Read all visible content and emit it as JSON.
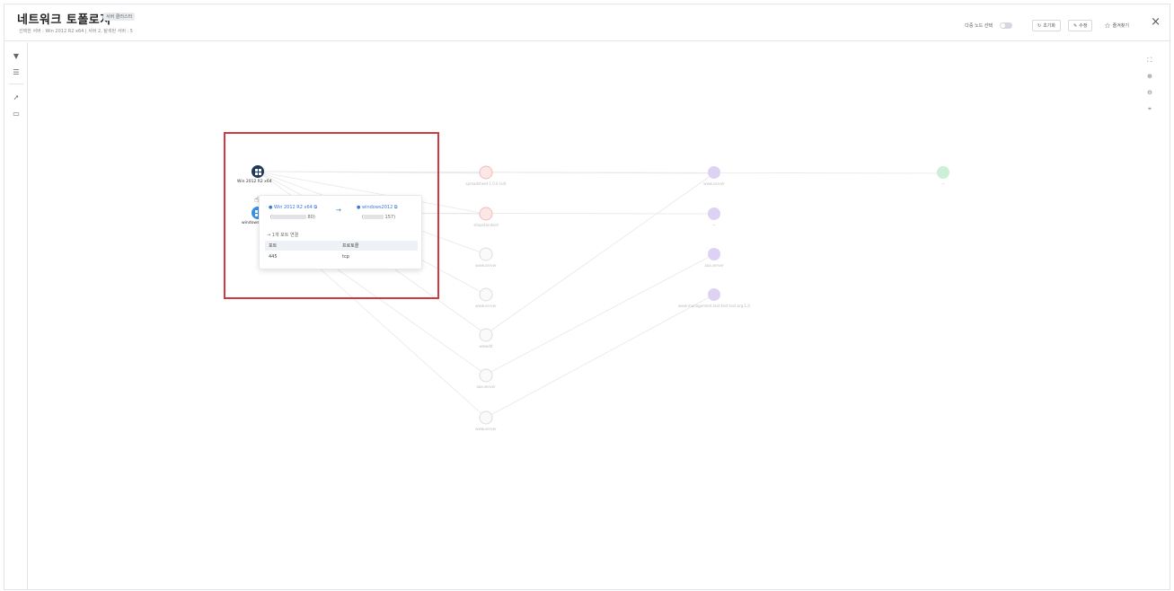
{
  "header": {
    "title": "네트워크 토폴로지",
    "badge": "서버 클러스터",
    "subtitle": "선택한 서버 : Win 2012 R2 x64 | 서버 2, 탐색된 서버 : 5",
    "multi_select_label": "다중 노드 선택",
    "reset_label": "초기화",
    "edit_label": "수정",
    "favorite_label": "즐겨찾기",
    "close": "×"
  },
  "left_toolbar": {
    "icons": [
      "filter-icon",
      "list-icon",
      "pointer-icon",
      "monitor-icon"
    ]
  },
  "right_toolbar": {
    "icons": [
      "fit-screen-icon",
      "zoom-in-icon",
      "zoom-out-icon",
      "center-icon"
    ]
  },
  "nodes": {
    "selected_label": "Win 2012 R2 x64",
    "second_label": "windows"
  },
  "popup": {
    "source_name": "Win 2012 R2 x64",
    "source_ip_suffix": "80)",
    "target_name": "windows2012",
    "target_ip_suffix": "157)",
    "connection_text": "1개 포트 연결",
    "columns": [
      "포트",
      "프로토콜"
    ],
    "rows": [
      [
        "445",
        "tcp"
      ]
    ]
  },
  "background_labels": {
    "n1": "spreadsheet 1.0.0 (sd)",
    "n2": "shopstandard",
    "n3": "www.server",
    "n4": "www.server",
    "n5": "wwwdd",
    "n6": "aaa.server",
    "n7": "www.server",
    "n8": "www.server",
    "n9": "—",
    "n10": "aaa.server",
    "n11": "www.management.test.test.test.org.1.0",
    "n12": "—"
  },
  "colors": {
    "selection_box": "#d0393e",
    "link": "#3a78d8",
    "node_dark": "#1f3a5f",
    "node_blue": "#3a8fe0",
    "node_purple": "#c9b7ec",
    "node_green": "#b8e6c8",
    "node_red": "#f2bcbc"
  }
}
